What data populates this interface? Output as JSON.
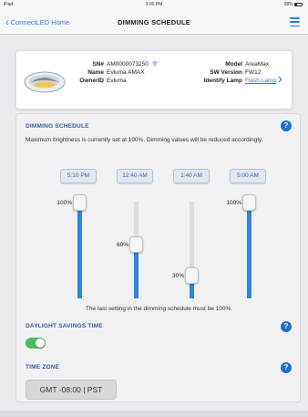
{
  "status_bar": {
    "carrier": "iPad",
    "time": "3:00 PM",
    "battery": "28%"
  },
  "nav": {
    "back_label": "ConnectLED Home",
    "title": "DIMMING SCHEDULE",
    "menu_icon": "hamburger-menu-icon"
  },
  "device": {
    "sn_label": "SN#",
    "sn_value": "AM0000073250",
    "name_label": "Name",
    "name_value": "Evluma AMAX",
    "owner_label": "OwnerID",
    "owner_value": "Evluma",
    "model_label": "Model",
    "model_value": "AreaMax",
    "sw_label": "SW Version",
    "sw_value": "FW12",
    "identify_label": "Identify Lamp",
    "identify_link": "Flash Lamp",
    "signal_icon": "wifi-icon"
  },
  "schedule": {
    "title": "DIMMING SCHEDULE",
    "description": "Maximum brightness is currently set at 100%. Dimming values will be reduced accordingly.",
    "slots": [
      {
        "time": "5:10 PM",
        "level": 100,
        "label": "100%"
      },
      {
        "time": "12:40 AM",
        "level": 60,
        "label": "60%"
      },
      {
        "time": "1:40 AM",
        "level": 30,
        "label": "30%"
      },
      {
        "time": "5:00 AM",
        "level": 100,
        "label": "100%"
      }
    ],
    "note": "The last setting in the dimming schedule must be 100%."
  },
  "dst": {
    "title": "DAYLIGHT SAVINGS TIME",
    "enabled": true
  },
  "timezone": {
    "title": "TIME ZONE",
    "value": "GMT -08:00 | PST"
  },
  "colors": {
    "accent": "#2c7be5",
    "section_title": "#355e9b",
    "toggle_on": "#4cbd5e",
    "slider_fill": "#2f86e0"
  }
}
